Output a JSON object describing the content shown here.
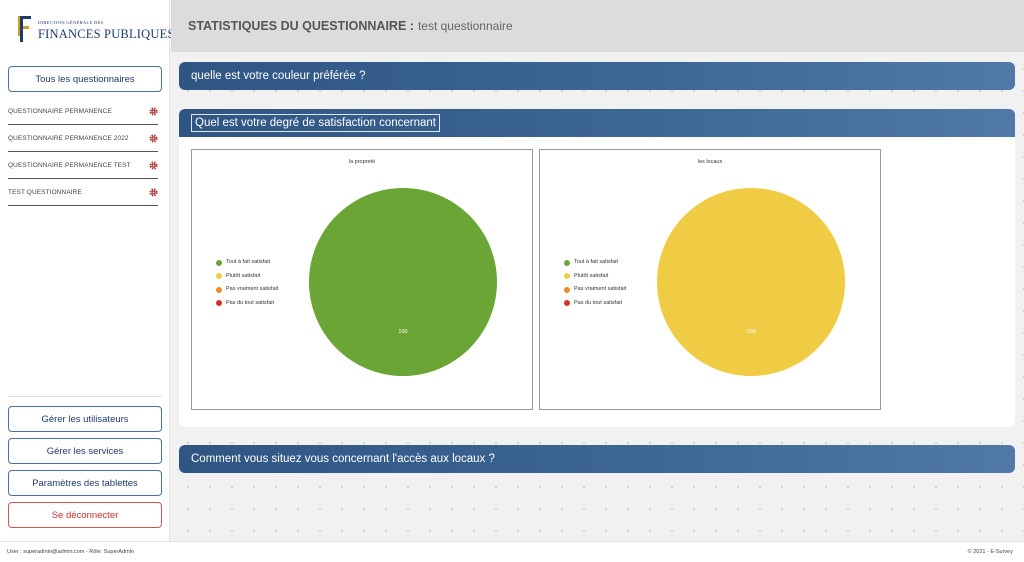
{
  "logo": {
    "line1": "DIRECTION GÉNÉRALE DES",
    "line2": "FINANCES PUBLIQUES"
  },
  "sidebar": {
    "all_questionnaires": "Tous les questionnaires",
    "questionnaires": [
      {
        "label": "QUESTIONNAIRE PERMANENCE"
      },
      {
        "label": "QUESTIONNAIRE PERMANENCE 2022"
      },
      {
        "label": "QUESTIONNAIRE PERMANENCE TEST"
      },
      {
        "label": "TEST QUESTIONNAIRE"
      }
    ],
    "manage_users": "Gérer les utilisateurs",
    "manage_services": "Gérer les services",
    "tablet_settings": "Paramètres des tablettes",
    "logout": "Se déconnecter"
  },
  "header": {
    "title": "STATISTIQUES DU QUESTIONNAIRE :",
    "subtitle": "test questionnaire"
  },
  "questions": [
    {
      "title": "quelle est votre couleur préférée ?"
    },
    {
      "title": "Quel est votre degré de satisfaction concernant"
    },
    {
      "title": "Comment vous situez vous concernant l'accès aux locaux ?"
    }
  ],
  "legend": [
    {
      "label": "Tout à fait satisfait",
      "color": "#6aa535"
    },
    {
      "label": "Plutôt satisfait",
      "color": "#f0cc45"
    },
    {
      "label": "Pas vraiment satisfait",
      "color": "#ef8a2e"
    },
    {
      "label": "Pas du tout satisfait",
      "color": "#d9322a"
    }
  ],
  "chart_data": [
    {
      "type": "pie",
      "title": "la propreté",
      "categories": [
        "Tout à fait satisfait",
        "Plutôt satisfait",
        "Pas vraiment satisfait",
        "Pas du tout satisfait"
      ],
      "values": [
        100,
        0,
        0,
        0
      ],
      "data_label": "100",
      "legend_position": "left"
    },
    {
      "type": "pie",
      "title": "les locaux",
      "categories": [
        "Tout à fait satisfait",
        "Plutôt satisfait",
        "Pas vraiment satisfait",
        "Pas du tout satisfait"
      ],
      "values": [
        0,
        100,
        0,
        0
      ],
      "data_label": "100",
      "legend_position": "left"
    }
  ],
  "footer": {
    "user": "User : superadmin@admin.com - Rôle: SuperAdmin",
    "copyright": "© 2021 - E-Survey"
  }
}
